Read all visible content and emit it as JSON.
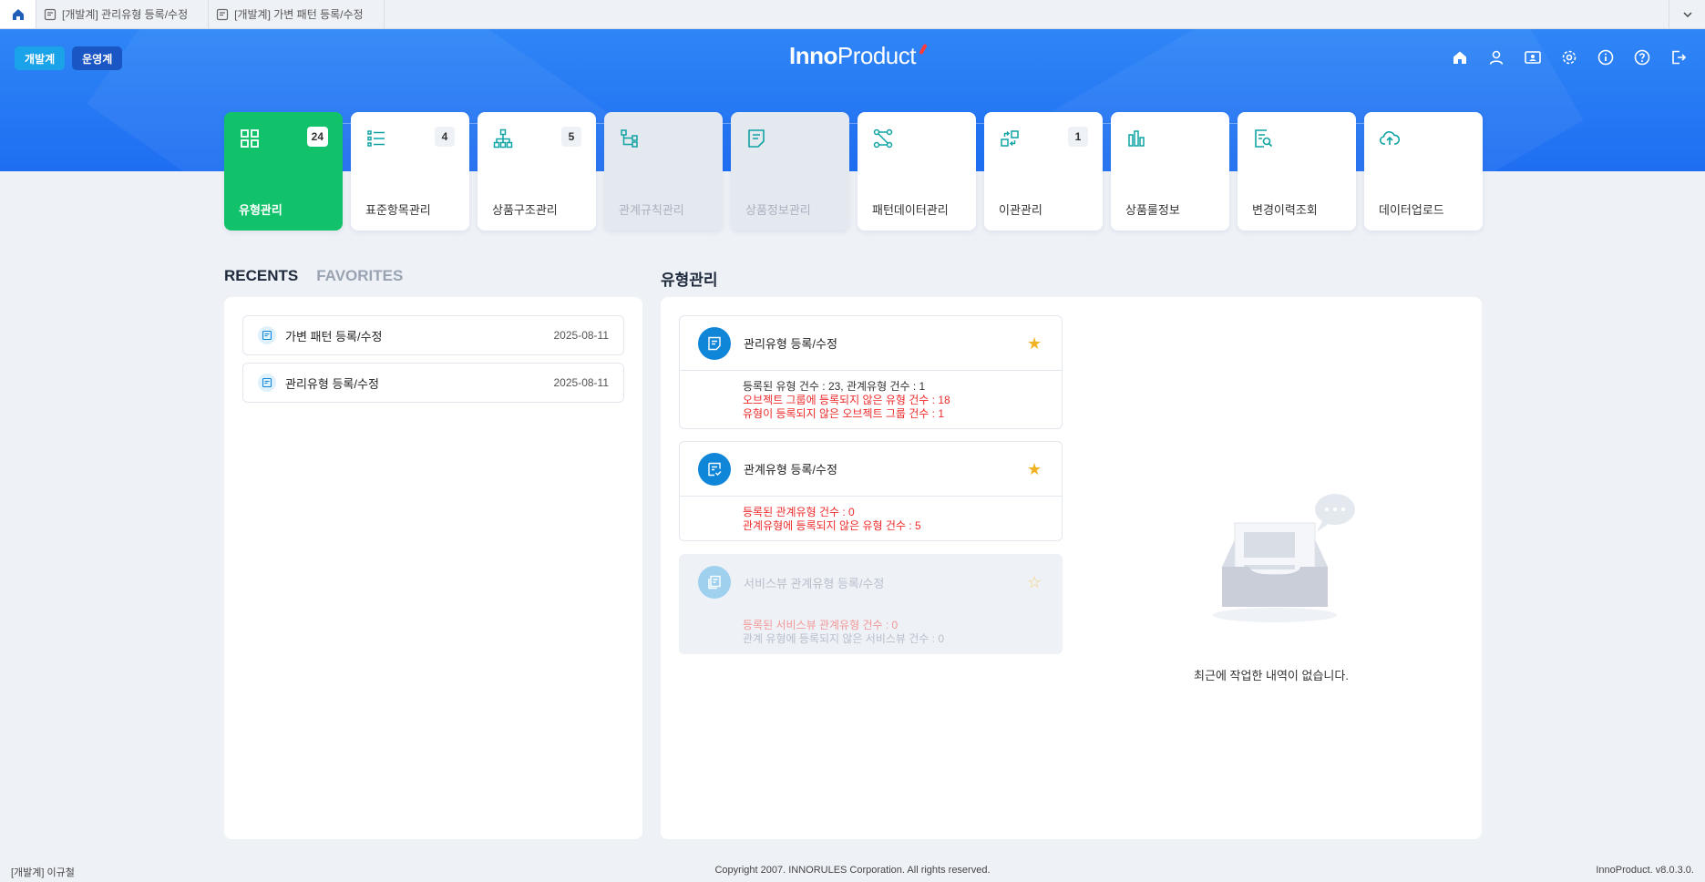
{
  "tabs": [
    {
      "icon": "document-icon",
      "label": "[개발계] 관리유형 등록/수정"
    },
    {
      "icon": "document-icon",
      "label": "[개발계] 가변 패턴 등록/수정"
    }
  ],
  "header": {
    "env_buttons": [
      "개발계",
      "운영계"
    ],
    "logo_bold": "Inno",
    "logo_light": "Product",
    "icons": [
      "home-icon",
      "user-icon",
      "profile-card-icon",
      "settings-icon",
      "info-icon",
      "help-icon",
      "logout-icon"
    ]
  },
  "menu": [
    {
      "label": "유형관리",
      "badge": "24",
      "state": "active",
      "icon": "grid-icon"
    },
    {
      "label": "표준항목관리",
      "badge": "4",
      "state": "normal",
      "icon": "list-icon"
    },
    {
      "label": "상품구조관리",
      "badge": "5",
      "state": "normal",
      "icon": "hierarchy-icon"
    },
    {
      "label": "관계규칙관리",
      "badge": "",
      "state": "disabled",
      "icon": "tree-icon"
    },
    {
      "label": "상품정보관리",
      "badge": "",
      "state": "disabled",
      "icon": "document-icon"
    },
    {
      "label": "패턴데이터관리",
      "badge": "",
      "state": "normal",
      "icon": "pattern-icon"
    },
    {
      "label": "이관관리",
      "badge": "1",
      "state": "normal",
      "icon": "transfer-icon"
    },
    {
      "label": "상품룰정보",
      "badge": "",
      "state": "normal",
      "icon": "bar-chart-icon"
    },
    {
      "label": "변경이력조회",
      "badge": "",
      "state": "normal",
      "icon": "search-document-icon"
    },
    {
      "label": "데이터업로드",
      "badge": "",
      "state": "normal",
      "icon": "cloud-upload-icon"
    }
  ],
  "left": {
    "tab_recents": "RECENTS",
    "tab_favorites": "FAVORITES",
    "items": [
      {
        "label": "가변 패턴 등록/수정",
        "date": "2025-08-11"
      },
      {
        "label": "관리유형 등록/수정",
        "date": "2025-08-11"
      }
    ]
  },
  "right": {
    "title": "유형관리",
    "cards": [
      {
        "title": "관리유형 등록/수정",
        "lines": [
          {
            "text": "등록된 유형 건수 : 23, 관계유형 건수 : 1",
            "kind": "normal"
          },
          {
            "text": "오브젝트 그룹에 등록되지 않은 유형 건수 : 18",
            "kind": "warn"
          },
          {
            "text": "유형이 등록되지 않은 오브젝트 그룹 건수 : 1",
            "kind": "warn"
          }
        ]
      },
      {
        "title": "관계유형 등록/수정",
        "lines": [
          {
            "text": "등록된 관계유형 건수 : 0",
            "kind": "warn"
          },
          {
            "text": "관계유형에 등록되지 않은 유형 건수 : 5",
            "kind": "warn"
          }
        ]
      },
      {
        "title": "서비스뷰 관계유형 등록/수정",
        "lines": [
          {
            "text": "등록된 서비스뷰 관계유형 건수 : 0",
            "kind": "warn"
          },
          {
            "text": "관계 유형에 등록되지 않은 서비스뷰 건수 : 0",
            "kind": "muted"
          }
        ]
      }
    ],
    "empty_text": "최근에 작업한 내역이 없습니다."
  },
  "footer": {
    "user": "[개발계] 이규철",
    "copyright": "Copyright 2007. INNORULES Corporation. All rights reserved.",
    "version": "InnoProduct. v8.0.3.0."
  },
  "colors": {
    "header_blue": "#2f86f6",
    "active_green": "#12c26b",
    "icon_teal": "#0fa3a3",
    "warn_red": "#ee2b2b",
    "star_gold": "#f0b323",
    "step_active": "#f5a623"
  }
}
